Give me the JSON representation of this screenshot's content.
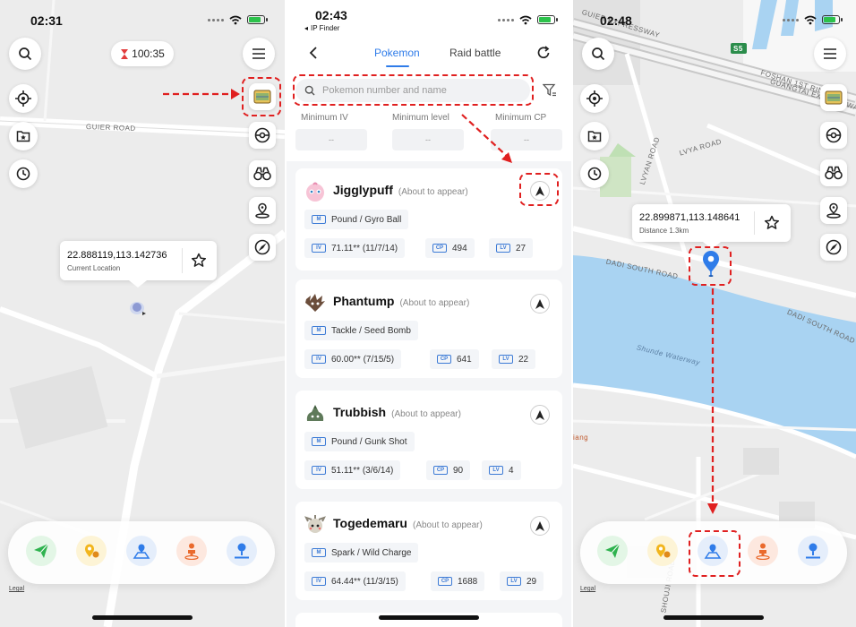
{
  "panel1": {
    "time": "02:31",
    "timer": "100:35",
    "road_label": "GUIER ROAD",
    "location": {
      "coords": "22.888119,113.142736",
      "label": "Current Location"
    },
    "legal": "Legal"
  },
  "panel2": {
    "time": "02:43",
    "back_app": "IP Finder",
    "tabs": [
      {
        "label": "Pokemon",
        "active": true
      },
      {
        "label": "Raid battle",
        "active": false
      }
    ],
    "search_placeholder": "Pokemon number and name",
    "filters": [
      {
        "label": "Minimum IV",
        "value": "--"
      },
      {
        "label": "Minimum level",
        "value": "--"
      },
      {
        "label": "Minimum CP",
        "value": "--"
      }
    ],
    "pokemon": [
      {
        "name": "Jigglypuff",
        "status": "(About to appear)",
        "moves": "Pound / Gyro Ball",
        "iv": "71.11** (11/7/14)",
        "cp": "494",
        "level": "27"
      },
      {
        "name": "Phantump",
        "status": "(About to appear)",
        "moves": "Tackle / Seed Bomb",
        "iv": "60.00** (7/15/5)",
        "cp": "641",
        "level": "22"
      },
      {
        "name": "Trubbish",
        "status": "(About to appear)",
        "moves": "Pound / Gunk Shot",
        "iv": "51.11** (3/6/14)",
        "cp": "90",
        "level": "4"
      },
      {
        "name": "Togedemaru",
        "status": "(About to appear)",
        "moves": "Spark / Wild Charge",
        "iv": "64.44** (11/3/15)",
        "cp": "1688",
        "level": "29"
      }
    ]
  },
  "panel3": {
    "time": "02:48",
    "road_labels": [
      "GUIER EXPRESSWAY",
      "S5",
      "FOSHAN 1ST RING",
      "GUANGTAI EXPRESSWAY",
      "LVYA ROAD",
      "LVYAN ROAD",
      "DADI SOUTH ROAD",
      "DADI SOUTH ROAD",
      "Shunde Waterway",
      "SHOUJI ROAD",
      "iang"
    ],
    "location": {
      "coords": "22.899871,113.148641",
      "label": "Distance 1.3km"
    },
    "legal": "Legal"
  },
  "colors": {
    "accent": "#2f7ce9",
    "highlight": "#e02020",
    "water": "#a9d3f2"
  }
}
